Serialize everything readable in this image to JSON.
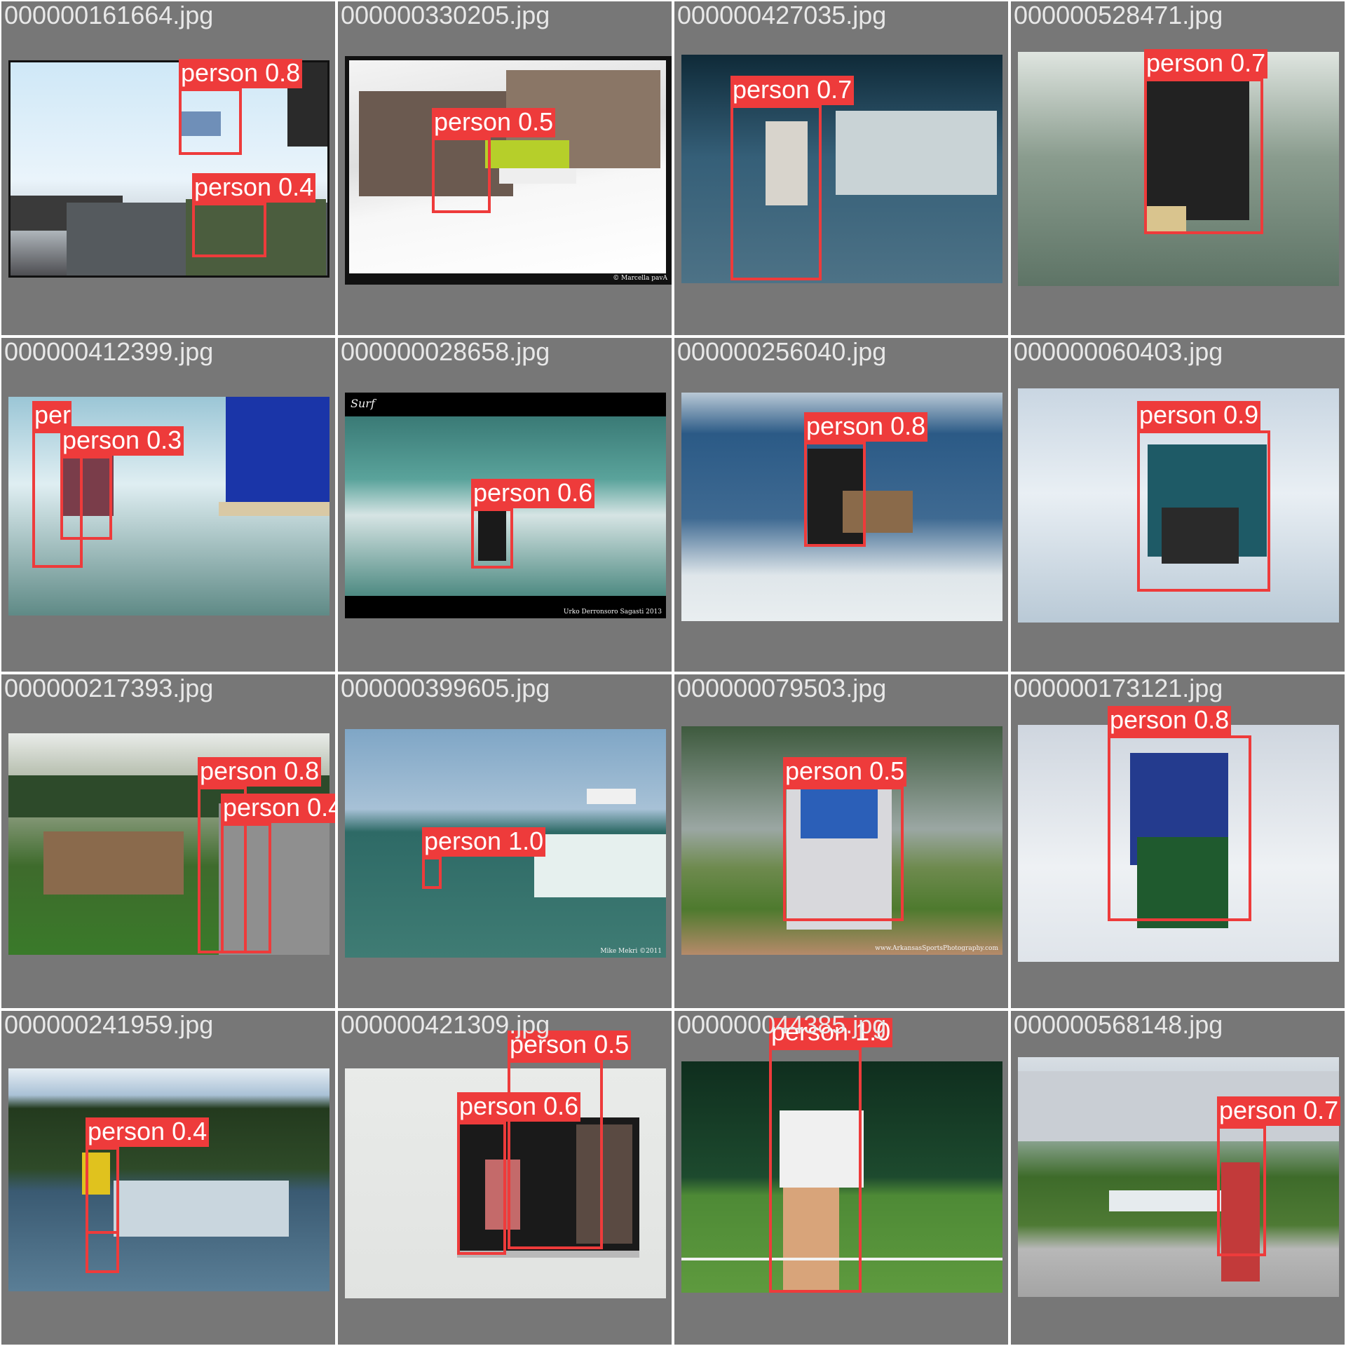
{
  "grid": {
    "colors": {
      "tile_background": "#777777",
      "filename_text": "#e8e8e8",
      "box": "#ee3b3b",
      "label_text": "#ffffff"
    },
    "tiles": [
      {
        "filename": "000000161664.jpg",
        "detections": [
          {
            "label": "person 0.8"
          },
          {
            "label": "person 0.4"
          }
        ]
      },
      {
        "filename": "000000330205.jpg",
        "credit": "© Marcella pavA",
        "detections": [
          {
            "label": "person 0.5"
          }
        ]
      },
      {
        "filename": "000000427035.jpg",
        "detections": [
          {
            "label": "person 0.7"
          }
        ]
      },
      {
        "filename": "000000528471.jpg",
        "detections": [
          {
            "label": "person 0.7"
          }
        ]
      },
      {
        "filename": "000000412399.jpg",
        "detections": [
          {
            "label": "person 0.3"
          },
          {
            "label": "person 0.3"
          }
        ]
      },
      {
        "filename": "000000028658.jpg",
        "caption": "Surf",
        "credit": "Urko Derronsoro Sagasti 2013",
        "detections": [
          {
            "label": "person 0.6"
          }
        ]
      },
      {
        "filename": "000000256040.jpg",
        "detections": [
          {
            "label": "person 0.8"
          }
        ]
      },
      {
        "filename": "000000060403.jpg",
        "detections": [
          {
            "label": "person 0.9"
          }
        ]
      },
      {
        "filename": "000000217393.jpg",
        "detections": [
          {
            "label": "person 0.8"
          },
          {
            "label": "person 0.4"
          }
        ]
      },
      {
        "filename": "000000399605.jpg",
        "credit": "Mike Mekri ©2011",
        "detections": [
          {
            "label": "person 1.0"
          }
        ]
      },
      {
        "filename": "000000079503.jpg",
        "credit": "www.ArkansasSportsPhotography.com",
        "detections": [
          {
            "label": "person 0.5"
          }
        ]
      },
      {
        "filename": "000000173121.jpg",
        "detections": [
          {
            "label": "person 0.8"
          }
        ]
      },
      {
        "filename": "000000241959.jpg",
        "detections": [
          {
            "label": "person 0.4"
          },
          {
            "label": "person 0.4"
          }
        ]
      },
      {
        "filename": "000000421309.jpg",
        "detections": [
          {
            "label": "person 0.5"
          },
          {
            "label": "person 0.6"
          }
        ]
      },
      {
        "filename": "000000044385.jpg",
        "detections": [
          {
            "label": "person 1.0"
          }
        ]
      },
      {
        "filename": "000000568148.jpg",
        "detections": [
          {
            "label": "person 0.7"
          }
        ]
      }
    ]
  }
}
